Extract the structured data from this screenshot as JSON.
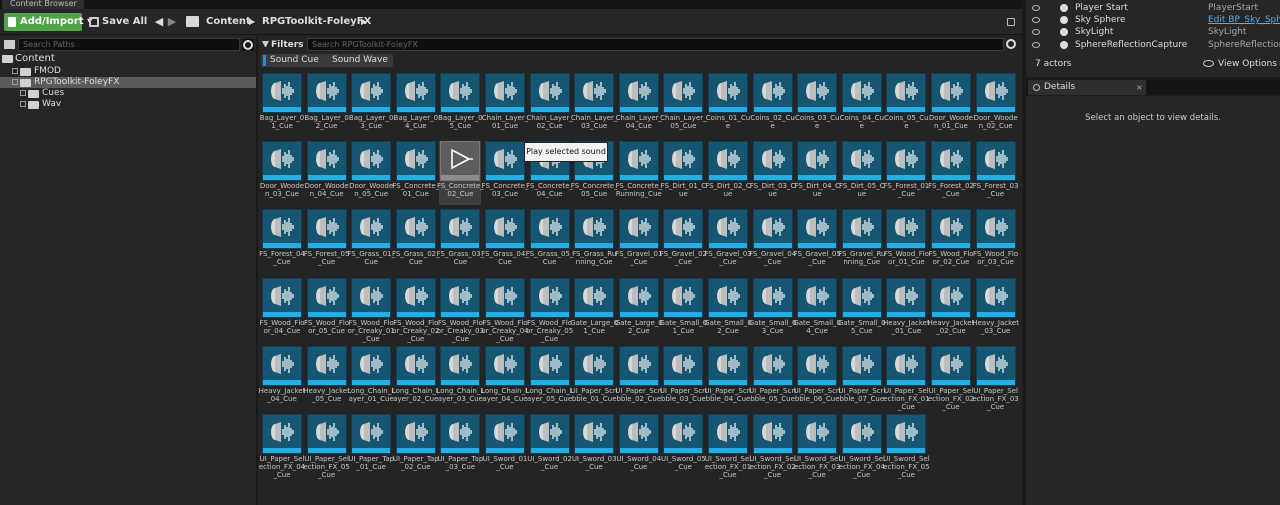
{
  "window": {
    "tab_title": "Content Browser"
  },
  "toolbar": {
    "add_import_label": "Add/Import",
    "save_all_label": "Save All",
    "breadcrumb": [
      "Content",
      "RPGToolkit-FoleyFX"
    ]
  },
  "sources": {
    "search_placeholder": "Search Paths",
    "tree": [
      {
        "label": "Content",
        "level": 0
      },
      {
        "label": "FMOD",
        "level": 1
      },
      {
        "label": "RPGToolkit-FoleyFX",
        "level": 1
      },
      {
        "label": "Cues",
        "level": 2
      },
      {
        "label": "Wav",
        "level": 2
      }
    ]
  },
  "assets": {
    "filters_label": "Filters",
    "search_placeholder": "Search RPGToolkit-FoleyFX",
    "filter_chips": [
      "Sound Cue",
      "Sound Wave"
    ],
    "tooltip": "Play selected sound",
    "selected_index": 21,
    "items": [
      [
        "Bag_Layer_01_Cue",
        "Bag_Layer_02_Cue",
        "Bag_Layer_03_Cue",
        "Bag_Layer_04_Cue",
        "Bag_Layer_05_Cue",
        "Chain_Layer_01_Cue",
        "Chain_Layer_02_Cue",
        "Chain_Layer_03_Cue",
        "Chain_Layer_04_Cue",
        "Chain_Layer_05_Cue",
        "Coins_01_Cue",
        "Coins_02_Cue",
        "Coins_03_Cue",
        "Coins_04_Cue",
        "Coins_05_Cue",
        "Door_Wooden_01_Cue",
        "Door_Wooden_02_Cue"
      ],
      [
        "Door_Wooden_03_Cue",
        "Door_Wooden_04_Cue",
        "Door_Wooden_05_Cue",
        "FS_Concrete_01_Cue",
        "FS_Concrete_02_Cue",
        "FS_Concrete_03_Cue",
        "FS_Concrete_04_Cue",
        "FS_Concrete_05_Cue",
        "FS_Concrete_Running_Cue",
        "FS_Dirt_01_Cue",
        "FS_Dirt_02_Cue",
        "FS_Dirt_03_Cue",
        "FS_Dirt_04_Cue",
        "FS_Dirt_05_Cue",
        "FS_Forest_01_Cue",
        "FS_Forest_02_Cue",
        "FS_Forest_03_Cue"
      ],
      [
        "FS_Forest_04_Cue",
        "FS_Forest_05_Cue",
        "FS_Grass_01_Cue",
        "FS_Grass_02_Cue",
        "FS_Grass_03_Cue",
        "FS_Grass_04_Cue",
        "FS_Grass_05_Cue",
        "FS_Grass_Running_Cue",
        "FS_Gravel_01_Cue",
        "FS_Gravel_02_Cue",
        "FS_Gravel_03_Cue",
        "FS_Gravel_04_Cue",
        "FS_Gravel_05_Cue",
        "FS_Gravel_Running_Cue",
        "FS_Wood_Floor_01_Cue",
        "FS_Wood_Floor_02_Cue",
        "FS_Wood_Floor_03_Cue"
      ],
      [
        "FS_Wood_Floor_04_Cue",
        "FS_Wood_Floor_05_Cue",
        "FS_Wood_Floor_Creaky_01_Cue",
        "FS_Wood_Floor_Creaky_02_Cue",
        "FS_Wood_Floor_Creaky_03_Cue",
        "FS_Wood_Floor_Creaky_04_Cue",
        "FS_Wood_Floor_Creaky_05_Cue",
        "Gate_Large_01_Cue",
        "Gate_Large_02_Cue",
        "Gate_Small_01_Cue",
        "Gate_Small_02_Cue",
        "Gate_Small_03_Cue",
        "Gate_Small_04_Cue",
        "Gate_Small_05_Cue",
        "Heavy_Jacket_01_Cue",
        "Heavy_Jacket_02_Cue",
        "Heavy_Jacket_03_Cue"
      ],
      [
        "Heavy_Jacket_04_Cue",
        "Heavy_Jacket_05_Cue",
        "Long_Chain_Layer_01_Cue",
        "Long_Chain_Layer_02_Cue",
        "Long_Chain_Layer_03_Cue",
        "Long_Chain_Layer_04_Cue",
        "Long_Chain_Layer_05_Cue",
        "UI_Paper_Scribble_01_Cue",
        "UI_Paper_Scribble_02_Cue",
        "UI_Paper_Scribble_03_Cue",
        "UI_Paper_Scribble_04_Cue",
        "UI_Paper_Scribble_05_Cue",
        "UI_Paper_Scribble_06_Cue",
        "UI_Paper_Scribble_07_Cue",
        "UI_Paper_Selection_FX_01_Cue",
        "UI_Paper_Selection_FX_02_Cue",
        "UI_Paper_Selection_FX_03_Cue"
      ],
      [
        "UI_Paper_Selection_FX_04_Cue",
        "UI_Paper_Selection_FX_05_Cue",
        "UI_Paper_Tap_01_Cue",
        "UI_Paper_Tap_02_Cue",
        "UI_Paper_Tap_03_Cue",
        "UI_Sword_01_Cue",
        "UI_Sword_02_Cue",
        "UI_Sword_03_Cue",
        "UI_Sword_04_Cue",
        "UI_Sword_05_Cue",
        "UI_Sword_Selection_FX_01_Cue",
        "UI_Sword_Selection_FX_02_Cue",
        "UI_Sword_Selection_FX_03_Cue",
        "UI_Sword_Selection_FX_04_Cue",
        "UI_Sword_Selection_FX_05_Cue"
      ]
    ],
    "labels_display": [
      [
        "Bag_Layer_\n01_Cue",
        "Bag_Layer_\n02_Cue",
        "Bag_Layer_\n03_Cue",
        "Bag_Layer_\n04_Cue",
        "Bag_Layer_\n05_Cue",
        "Chain_Layer\n_01_Cue",
        "Chain_Layer\n_02_Cue",
        "Chain_Layer\n_03_Cue",
        "Chain_Layer\n_04_Cue",
        "Chain_Layer\n_05_Cue",
        "Coins_01_\nCue",
        "Coins_02_\nCue",
        "Coins_03_\nCue",
        "Coins_04_\nCue",
        "Coins_05_\nCue",
        "Door_\nWooden_01_\nCue",
        "Door_\nWooden_02_\nCue"
      ],
      [
        "Door_\nWooden_03_\nCue",
        "Door_\nWooden_04_\nCue",
        "Door_\nWooden_05_\nCue",
        "FS_Concrete\n_01_Cue",
        "FS_Concrete\n_02_Cue",
        "FS_Concrete\n_03_Cue",
        "FS_Concrete\n_04_Cue",
        "FS_Concrete\n_05_Cue",
        "FS_Concrete\n_Running_\nCue",
        "FS_Dirt_01_\nCue",
        "FS_Dirt_02_\nCue",
        "FS_Dirt_03_\nCue",
        "FS_Dirt_04_\nCue",
        "FS_Dirt_05_\nCue",
        "FS_Forest_\n01_Cue",
        "FS_Forest_\n02_Cue",
        "FS_Forest_\n03_Cue"
      ],
      [
        "FS_Forest_\n04_Cue",
        "FS_Forest_\n05_Cue",
        "FS_Grass_\n01_Cue",
        "FS_Grass_\n02_Cue",
        "FS_Grass_\n03_Cue",
        "FS_Grass_\n04_Cue",
        "FS_Grass_\n05_Cue",
        "FS_Grass_\nRunning_\nCue",
        "FS_Gravel_\n01_Cue",
        "FS_Gravel_\n02_Cue",
        "FS_Gravel_\n03_Cue",
        "FS_Gravel_\n04_Cue",
        "FS_Gravel_\n05_Cue",
        "FS_Gravel_\nRunning_\nCue",
        "FS_Wood_\nFloor_01_\nCue",
        "FS_Wood_\nFloor_02_\nCue",
        "FS_Wood_\nFloor_03_\nCue"
      ],
      [
        "FS_Wood_\nFloor_04_\nCue",
        "FS_Wood_\nFloor_05_\nCue",
        "FS_Wood_\nFloor_Creaky\n_01_Cue",
        "FS_Wood_\nFloor_Creaky\n_02_Cue",
        "FS_Wood_\nFloor_Creaky\n_03_Cue",
        "FS_Wood_\nFloor_Creaky\n_04_Cue",
        "FS_Wood_\nFloor_Creaky\n_05_Cue",
        "Gate_Large_\n01_Cue",
        "Gate_Large_\n02_Cue",
        "Gate_Small_\n01_Cue",
        "Gate_Small_\n02_Cue",
        "Gate_Small_\n03_Cue",
        "Gate_Small_\n04_Cue",
        "Gate_Small_\n05_Cue",
        "Heavy_\nJacket_01_\nCue",
        "Heavy_\nJacket_02_\nCue",
        "Heavy_\nJacket_03_\nCue"
      ],
      [
        "Heavy_\nJacket_04_\nCue",
        "Heavy_\nJacket_05_\nCue",
        "Long_Chain\n_Layer_01_\nCue",
        "Long_Chain\n_Layer_02_\nCue",
        "Long_Chain\n_Layer_03_\nCue",
        "Long_Chain\n_Layer_04_\nCue",
        "Long_Chain\n_Layer_05_\nCue",
        "UI_Paper_\nScribble_01_\nCue",
        "UI_Paper_\nScribble_02_\nCue",
        "UI_Paper_\nScribble_03_\nCue",
        "UI_Paper_\nScribble_04_\nCue",
        "UI_Paper_\nScribble_05_\nCue",
        "UI_Paper_\nScribble_06_\nCue",
        "UI_Paper_\nScribble_07_\nCue",
        "UI_Paper_\nSelection_FX\n_01_Cue",
        "UI_Paper_\nSelection_FX\n_02_Cue",
        "UI_Paper_\nSelection_FX\n_03_Cue"
      ],
      [
        "UI_Paper_\nSelection_FX\n_04_Cue",
        "UI_Paper_\nSelection_FX\n_05_Cue",
        "UI_Paper_\nTap_01_Cue",
        "UI_Paper_\nTap_02_Cue",
        "UI_Paper_\nTap_03_Cue",
        "UI_Sword_01\n_Cue",
        "UI_Sword_02\n_Cue",
        "UI_Sword_03\n_Cue",
        "UI_Sword_04\n_Cue",
        "UI_Sword_05\n_Cue",
        "UI_Sword_\nSelection_FX\n_01_Cue",
        "UI_Sword_\nSelection_FX\n_02_Cue",
        "UI_Sword_\nSelection_FX\n_03_Cue",
        "UI_Sword_\nSelection_FX\n_04_Cue",
        "UI_Sword_\nSelection_FX\n_05_Cue"
      ]
    ]
  },
  "outliner": {
    "rows": [
      {
        "name": "Player Start",
        "type": "PlayerStart",
        "link": false
      },
      {
        "name": "Sky Sphere",
        "type": "Edit BP_Sky_Sphe",
        "link": true
      },
      {
        "name": "SkyLight",
        "type": "SkyLight",
        "link": false
      },
      {
        "name": "SphereReflectionCapture",
        "type": "SphereReflectionC",
        "link": false
      }
    ],
    "actors_count": "7 actors",
    "view_options_label": "View Options"
  },
  "details": {
    "tab_label": "Details",
    "empty_message": "Select an object to view details."
  },
  "colors": {
    "accent_green": "#51a34a",
    "sound_cue_blue": "#24aee8",
    "link_blue": "#5aa9e6"
  }
}
